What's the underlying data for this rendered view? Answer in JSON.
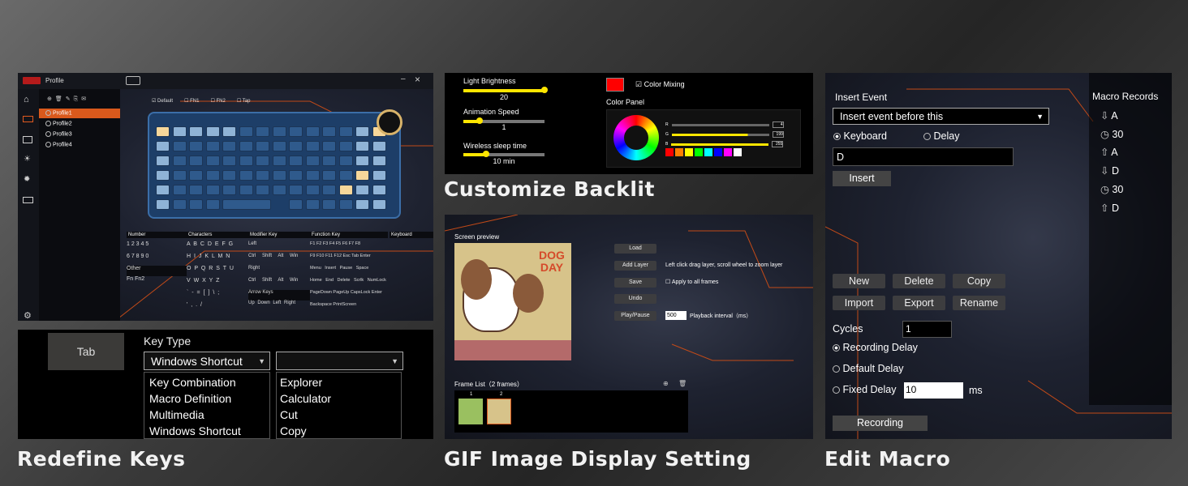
{
  "profile_window": {
    "title": "Profile",
    "profiles": [
      "Profile1",
      "Profile2",
      "Profile3",
      "Profile4"
    ],
    "layer_checks": [
      "Default",
      "FN1",
      "FN2",
      "Tap"
    ],
    "key_groups": [
      {
        "title": "Number",
        "rows": [
          "1 2 3 4 5",
          "6 7 8 9 0",
          "Other",
          "Fn Fn2"
        ]
      },
      {
        "title": "Characters",
        "rows": [
          "A B C D E F G",
          "H I J K L M N",
          "O P Q R S T U",
          "V W X Y Z",
          "` - = [ ] \\ ;",
          "' , . /"
        ]
      },
      {
        "title": "Modifier Key",
        "rows": [
          "Left",
          "Ctrl Shift Alt Win",
          "Right",
          "Ctrl Shift Alt Win",
          "Arrow Keys",
          "Up Down Left Right"
        ]
      },
      {
        "title": "Function Key",
        "rows": [
          "F1 F2 F3 F4 F5 F6 F7 F8",
          "F9 F10 F11 F12 Esc Tab Enter",
          "Menu Insert Pause Space",
          "Home End Delete Scrlk NumLock",
          "PageDown PageUp CapsLock Enter",
          "Backspace PrintScreen"
        ]
      },
      {
        "title": "Keyboard",
        "rows": [
          "",
          "",
          "",
          "",
          "",
          ""
        ]
      }
    ]
  },
  "redefine": {
    "key_label": "Tab",
    "key_type_label": "Key Type",
    "select_value": "Windows Shortcut",
    "type_options": [
      "Key Combination",
      "Macro Definition",
      "Multimedia",
      "Windows Shortcut"
    ],
    "shortcut_options": [
      "Explorer",
      "Calculator",
      "Cut",
      "Copy"
    ],
    "caption": "Redefine Keys"
  },
  "backlit": {
    "brightness_label": "Light Brightness",
    "brightness_value": "20",
    "brightness_pct": 1.0,
    "speed_label": "Animation Speed",
    "speed_value": "1",
    "speed_pct": 0.2,
    "sleep_label": "Wireless sleep time",
    "sleep_value": "10 min",
    "sleep_pct": 0.28,
    "color_mixing": "Color Mixing",
    "color_panel": "Color Panel",
    "rgb": [
      {
        "ch": "R",
        "val": "4"
      },
      {
        "ch": "G",
        "val": "199"
      },
      {
        "ch": "B",
        "val": "255"
      }
    ],
    "swatches": [
      "#ff0000",
      "#ff8000",
      "#ffff00",
      "#00ff00",
      "#00ffff",
      "#0000ff",
      "#ff00ff",
      "#ffffff"
    ],
    "current_color": "#ff0000",
    "caption": "Customize Backlit"
  },
  "gif": {
    "preview_label": "Screen preview",
    "preview_text": "DOG DAY",
    "buttons": [
      "Load",
      "Add Layer",
      "Save",
      "Undo",
      "Play/Pause"
    ],
    "hint": "Left click drag layer, scroll wheel to zoom layer",
    "apply_all": "Apply to all frames",
    "interval_value": "500",
    "interval_label": "Playback interval（ms）",
    "frame_list": "Frame List（2 frames）",
    "frame_numbers": [
      "1",
      "2"
    ],
    "caption": "GIF Image Display Setting"
  },
  "macro": {
    "insert_event": "Insert Event",
    "insert_select": "Insert event before this",
    "keyboard": "Keyboard",
    "delay": "Delay",
    "key_value": "D",
    "insert_btn": "Insert",
    "records_title": "Macro Records",
    "records": [
      {
        "icon": "down-arrow",
        "text": "A"
      },
      {
        "icon": "clock",
        "text": "30"
      },
      {
        "icon": "up-arrow",
        "text": "A"
      },
      {
        "icon": "down-arrow",
        "text": "D"
      },
      {
        "icon": "clock",
        "text": "30"
      },
      {
        "icon": "up-arrow",
        "text": "D"
      }
    ],
    "buttons": [
      "New",
      "Delete",
      "Copy",
      "Import",
      "Export",
      "Rename"
    ],
    "cycles_label": "Cycles",
    "cycles_value": "1",
    "recording_delay": "Recording Delay",
    "default_delay": "Default Delay",
    "fixed_delay": "Fixed Delay",
    "fixed_value": "10",
    "ms": "ms",
    "recording_btn": "Recording",
    "caption": "Edit Macro"
  }
}
